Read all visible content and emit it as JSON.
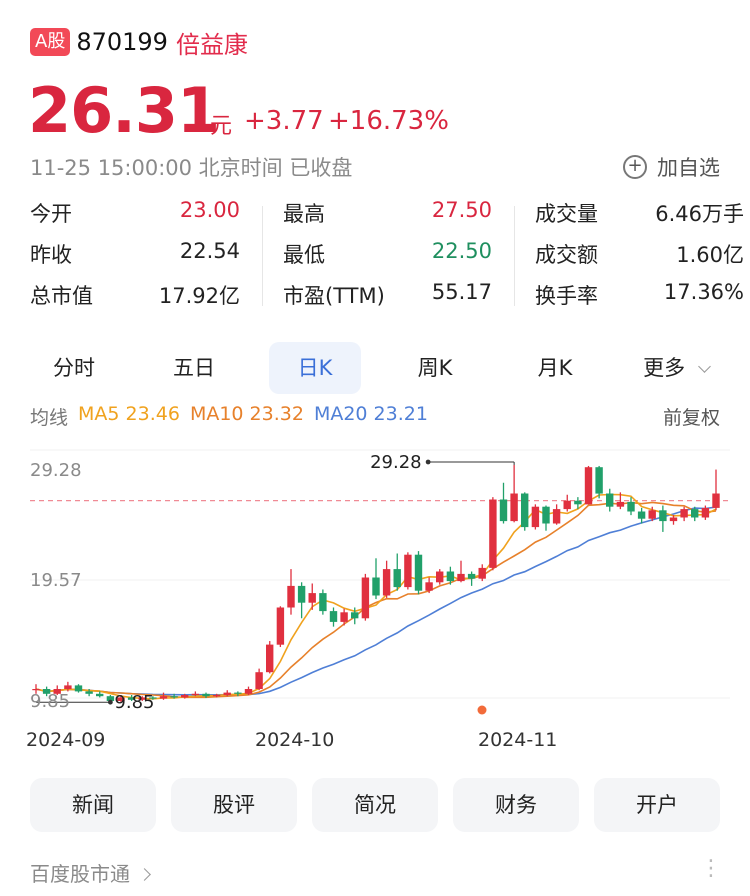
{
  "header": {
    "market_badge": "A股",
    "code": "870199",
    "name": "倍益康"
  },
  "quote": {
    "price": "26.31",
    "unit": "元",
    "change": "+3.77",
    "change_pct": "+16.73%",
    "timestamp": "11-25 15:00:00 北京时间 已收盘",
    "add_watchlist": "加自选"
  },
  "stats": [
    {
      "label": "今开",
      "value": "23.00",
      "color": "#d9263f"
    },
    {
      "label": "昨收",
      "value": "22.54",
      "color": "#222222"
    },
    {
      "label": "总市值",
      "value": "17.92亿",
      "color": "#222222"
    },
    {
      "label": "最高",
      "value": "27.50",
      "color": "#d9263f"
    },
    {
      "label": "最低",
      "value": "22.50",
      "color": "#1f8f5f"
    },
    {
      "label": "市盈(TTM)",
      "value": "55.17",
      "color": "#222222"
    },
    {
      "label": "成交量",
      "value": "6.46万手",
      "color": "#222222"
    },
    {
      "label": "成交额",
      "value": "1.60亿",
      "color": "#222222"
    },
    {
      "label": "换手率",
      "value": "17.36%",
      "color": "#222222"
    }
  ],
  "tabs": [
    "分时",
    "五日",
    "日K",
    "周K",
    "月K",
    "更多"
  ],
  "active_tab": "日K",
  "ma_legend": {
    "title": "均线",
    "ma5": "MA5 23.46",
    "ma10": "MA10 23.32",
    "ma20": "MA20 23.21",
    "colors": {
      "ma5": "#f0a21e",
      "ma10": "#e7812b",
      "ma20": "#4f7fd6"
    }
  },
  "adjust": "前复权",
  "colors": {
    "up": "#e0303f",
    "down": "#21a06a",
    "accent": "#3a6fd8"
  },
  "chart_data": {
    "type": "candlestick",
    "y_ticks": [
      "29.28",
      "19.57",
      "9.85"
    ],
    "x_ticks": [
      "2024-09",
      "2024-10",
      "2024-11"
    ],
    "annotations": {
      "high": "29.28",
      "low": "9.85"
    },
    "current_price_line": 26.31,
    "ylim": [
      9.2,
      30.2
    ],
    "candles": [
      [
        10.5,
        10.6,
        11.0,
        10.2
      ],
      [
        10.6,
        10.2,
        10.8,
        10.0
      ],
      [
        10.2,
        10.6,
        10.9,
        10.1
      ],
      [
        10.6,
        10.9,
        11.2,
        10.4
      ],
      [
        10.9,
        10.4,
        11.0,
        10.3
      ],
      [
        10.4,
        10.2,
        10.6,
        10.0
      ],
      [
        10.2,
        10.0,
        10.4,
        9.9
      ],
      [
        10.0,
        9.6,
        10.1,
        9.5
      ],
      [
        9.6,
        9.9,
        10.1,
        9.5
      ],
      [
        9.9,
        9.7,
        10.1,
        9.6
      ],
      [
        9.7,
        9.9,
        10.0,
        9.6
      ],
      [
        9.9,
        9.8,
        10.0,
        9.7
      ],
      [
        9.8,
        10.0,
        10.3,
        9.7
      ],
      [
        10.0,
        9.9,
        10.2,
        9.8
      ],
      [
        9.9,
        10.1,
        10.2,
        9.8
      ],
      [
        10.1,
        10.2,
        10.4,
        10.0
      ],
      [
        10.2,
        10.0,
        10.3,
        9.85
      ],
      [
        10.0,
        10.1,
        10.2,
        9.9
      ],
      [
        10.1,
        10.3,
        10.5,
        10.0
      ],
      [
        10.3,
        10.2,
        10.4,
        10.0
      ],
      [
        10.2,
        10.6,
        10.8,
        10.1
      ],
      [
        10.6,
        12.0,
        12.3,
        10.5
      ],
      [
        12.0,
        14.3,
        14.6,
        11.9
      ],
      [
        14.3,
        17.4,
        17.5,
        14.1
      ],
      [
        17.4,
        19.2,
        20.6,
        16.8
      ],
      [
        19.2,
        17.8,
        19.5,
        16.5
      ],
      [
        17.8,
        18.6,
        19.4,
        17.2
      ],
      [
        18.6,
        17.1,
        18.9,
        16.8
      ],
      [
        17.1,
        16.2,
        17.4,
        15.8
      ],
      [
        16.2,
        17.0,
        17.3,
        15.9
      ],
      [
        17.0,
        16.5,
        17.4,
        16.0
      ],
      [
        16.5,
        19.9,
        20.2,
        16.3
      ],
      [
        19.9,
        18.4,
        21.5,
        18.1
      ],
      [
        18.4,
        20.6,
        21.3,
        18.2
      ],
      [
        20.6,
        19.1,
        21.9,
        18.8
      ],
      [
        19.1,
        21.8,
        22.0,
        18.9
      ],
      [
        21.8,
        18.8,
        22.1,
        18.5
      ],
      [
        18.8,
        19.5,
        19.9,
        18.6
      ],
      [
        19.5,
        20.4,
        20.6,
        19.3
      ],
      [
        20.4,
        19.6,
        20.8,
        19.3
      ],
      [
        19.6,
        20.2,
        21.3,
        19.5
      ],
      [
        20.2,
        19.8,
        20.4,
        19.2
      ],
      [
        19.8,
        20.7,
        21.0,
        19.6
      ],
      [
        20.7,
        26.4,
        26.6,
        20.5
      ],
      [
        26.4,
        24.6,
        27.8,
        24.4
      ],
      [
        24.6,
        26.9,
        29.28,
        24.5
      ],
      [
        26.9,
        24.1,
        27.0,
        23.8
      ],
      [
        24.1,
        25.8,
        26.0,
        23.9
      ],
      [
        25.8,
        24.4,
        25.9,
        23.8
      ],
      [
        24.4,
        25.6,
        26.0,
        24.3
      ],
      [
        25.6,
        26.3,
        26.8,
        25.4
      ],
      [
        26.3,
        26.0,
        26.6,
        25.6
      ],
      [
        26.0,
        29.1,
        29.2,
        26.0
      ],
      [
        29.1,
        26.9,
        29.2,
        26.5
      ],
      [
        26.9,
        25.8,
        27.3,
        25.4
      ],
      [
        25.8,
        26.2,
        27.0,
        25.6
      ],
      [
        26.2,
        25.4,
        26.6,
        25.1
      ],
      [
        25.4,
        24.8,
        25.7,
        24.4
      ],
      [
        24.8,
        25.5,
        25.8,
        24.6
      ],
      [
        25.5,
        24.6,
        25.9,
        23.7
      ],
      [
        24.6,
        24.9,
        25.1,
        24.3
      ],
      [
        24.9,
        25.6,
        25.8,
        24.6
      ],
      [
        25.6,
        24.9,
        25.8,
        24.6
      ],
      [
        24.9,
        25.7,
        25.9,
        24.7
      ],
      [
        25.7,
        26.9,
        28.9,
        25.5
      ]
    ]
  }
}
